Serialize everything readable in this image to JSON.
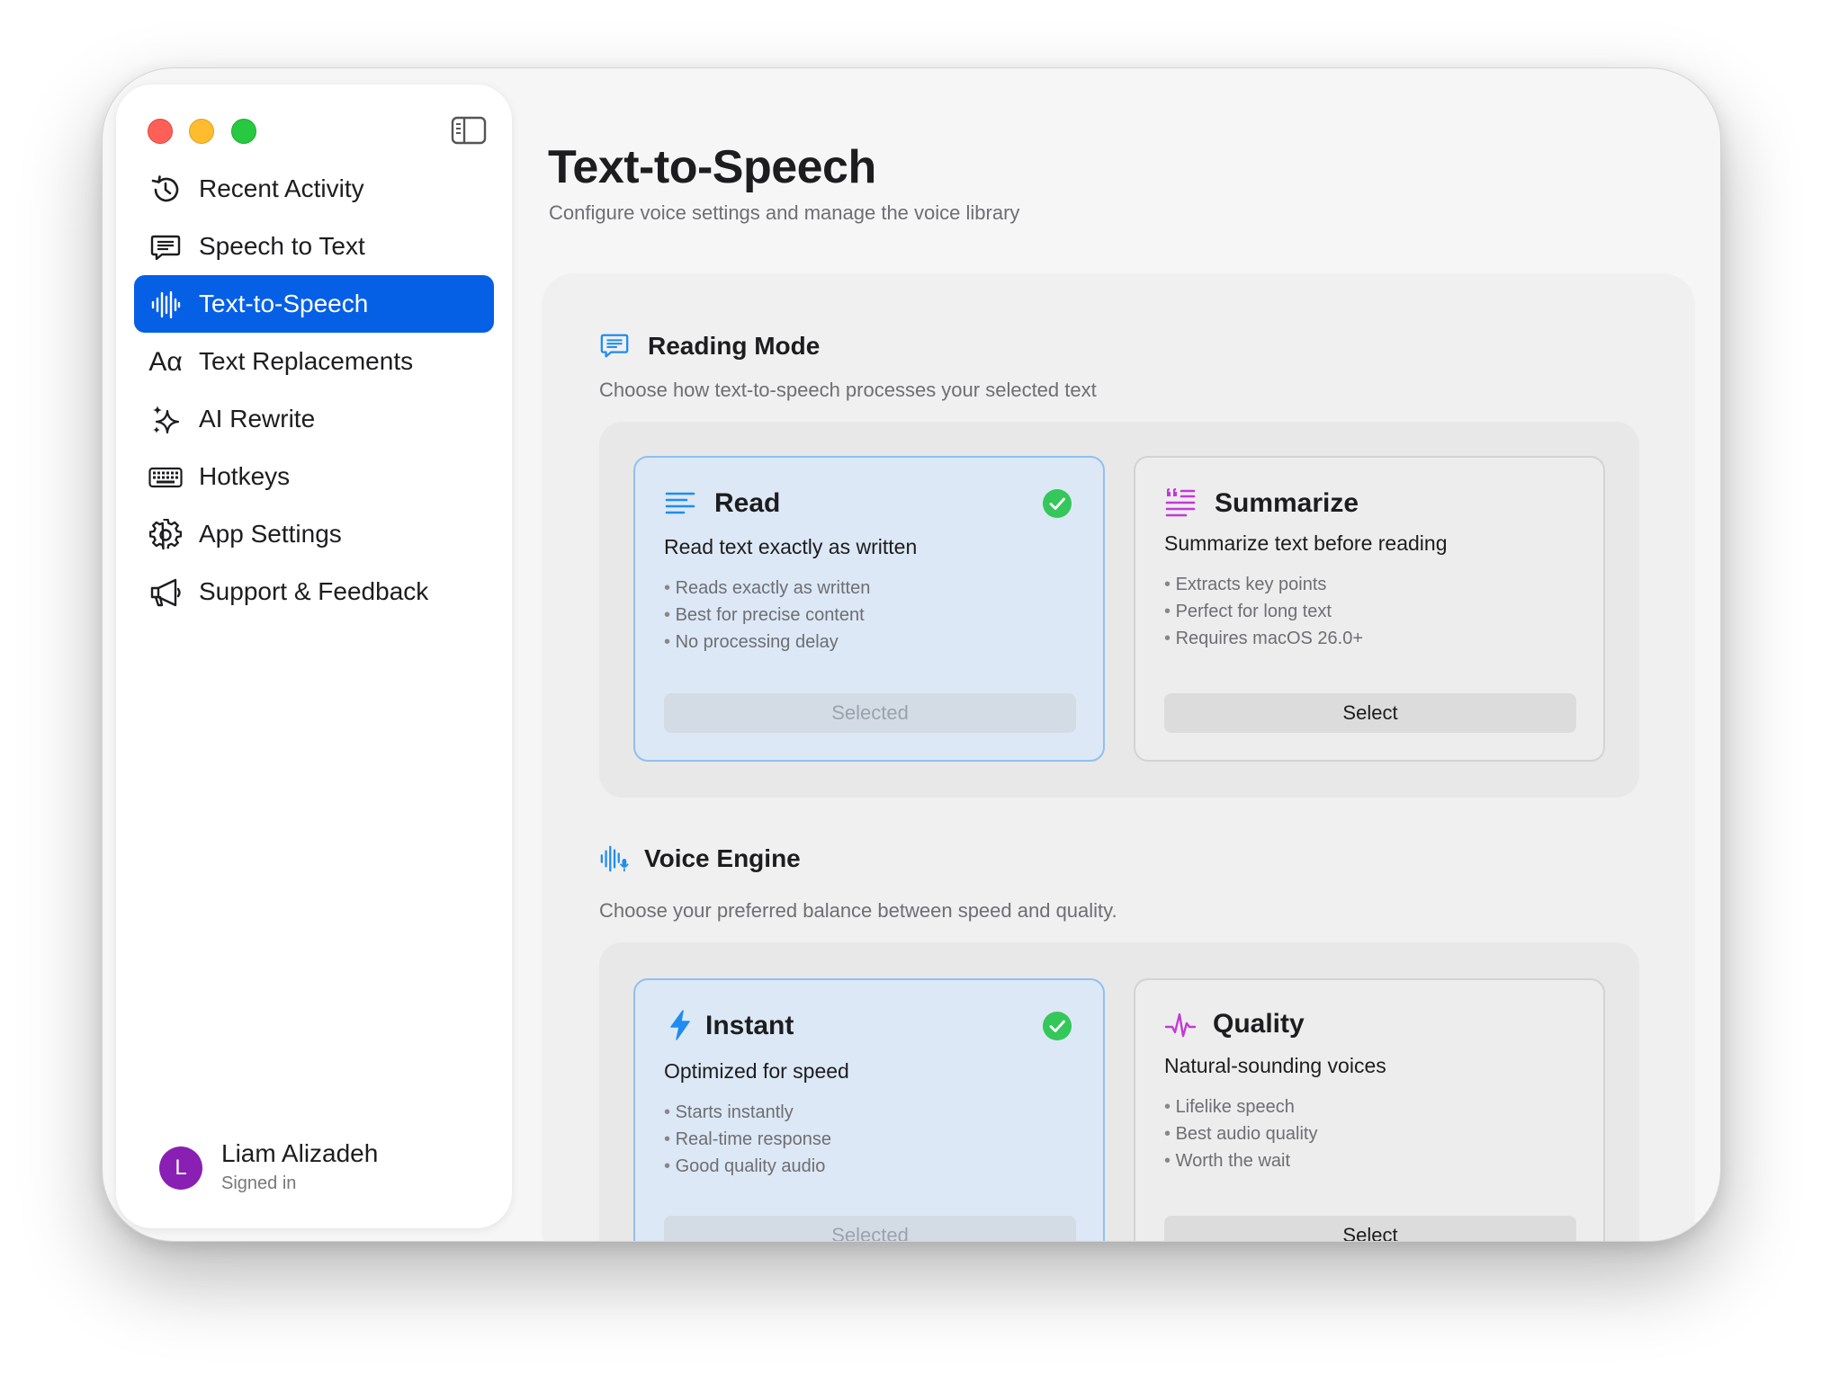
{
  "sidebar": {
    "items": [
      {
        "label": "Recent Activity",
        "icon": "history-icon",
        "active": false
      },
      {
        "label": "Speech to Text",
        "icon": "speech-bubble-icon",
        "active": false
      },
      {
        "label": "Text-to-Speech",
        "icon": "waveform-icon",
        "active": true
      },
      {
        "label": "Text Replacements",
        "icon": "text-format-icon",
        "active": false
      },
      {
        "label": "AI Rewrite",
        "icon": "sparkles-icon",
        "active": false
      },
      {
        "label": "Hotkeys",
        "icon": "keyboard-icon",
        "active": false
      },
      {
        "label": "App Settings",
        "icon": "gear-icon",
        "active": false
      },
      {
        "label": "Support & Feedback",
        "icon": "megaphone-icon",
        "active": false
      }
    ],
    "text_format_glyph": "Aα",
    "user": {
      "initial": "L",
      "name": "Liam Alizadeh",
      "status": "Signed in"
    }
  },
  "main": {
    "title": "Text-to-Speech",
    "subtitle": "Configure voice settings and manage the voice library"
  },
  "reading_mode": {
    "title": "Reading Mode",
    "description": "Choose how text-to-speech processes your selected text",
    "options": [
      {
        "title": "Read",
        "subtitle": "Read text exactly as written",
        "bullets": [
          "Reads exactly as written",
          "Best for precise content",
          "No processing delay"
        ],
        "button": "Selected",
        "selected": true
      },
      {
        "title": "Summarize",
        "subtitle": "Summarize text before reading",
        "bullets": [
          "Extracts key points",
          "Perfect for long text",
          "Requires macOS 26.0+"
        ],
        "button": "Select",
        "selected": false
      }
    ]
  },
  "voice_engine": {
    "title": "Voice Engine",
    "description": "Choose your preferred balance between speed and quality.",
    "options": [
      {
        "title": "Instant",
        "subtitle": "Optimized for speed",
        "bullets": [
          "Starts instantly",
          "Real-time response",
          "Good quality audio"
        ],
        "button": "Selected",
        "selected": true
      },
      {
        "title": "Quality",
        "subtitle": "Natural-sounding voices",
        "bullets": [
          "Lifelike speech",
          "Best audio quality",
          "Worth the wait"
        ],
        "button": "Select",
        "selected": false
      }
    ]
  },
  "colors": {
    "accent": "#0660e6",
    "icon_blue": "#1e8cf0",
    "icon_purple": "#c23ad6",
    "check_green": "#34c759",
    "avatar": "#8a1fb4"
  }
}
